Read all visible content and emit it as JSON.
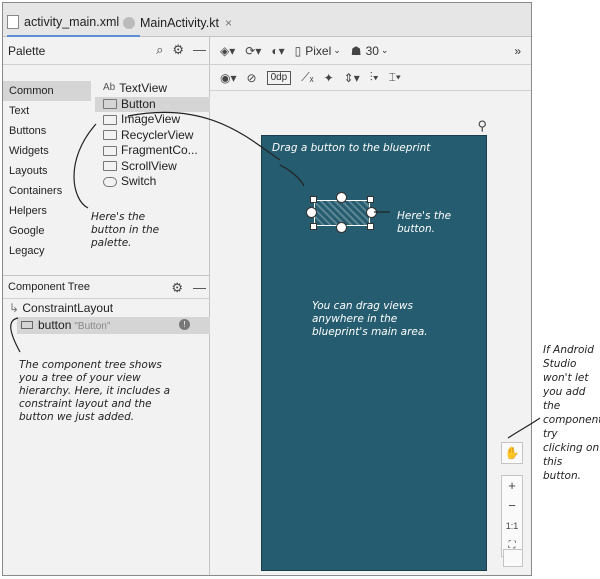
{
  "tabs": [
    {
      "label": "activity_main.xml"
    },
    {
      "label": "MainActivity.kt"
    }
  ],
  "palette": {
    "title": "Palette",
    "categories": [
      "Common",
      "Text",
      "Buttons",
      "Widgets",
      "Layouts",
      "Containers",
      "Helpers",
      "Google",
      "Legacy"
    ],
    "items": [
      {
        "label": "TextView",
        "icon": "Ab"
      },
      {
        "label": "Button",
        "icon": ""
      },
      {
        "label": "ImageView",
        "icon": ""
      },
      {
        "label": "RecyclerView",
        "icon": ""
      },
      {
        "label": "FragmentCo...",
        "icon": ""
      },
      {
        "label": "ScrollView",
        "icon": ""
      },
      {
        "label": "Switch",
        "icon": ""
      }
    ]
  },
  "component_tree": {
    "title": "Component Tree",
    "root": "ConstraintLayout",
    "child": "button",
    "child_hint": "\"Button\""
  },
  "toolbar": {
    "device": "Pixel",
    "api": "30",
    "margin": "0dp"
  },
  "zoom": {
    "plus": "+",
    "minus": "−",
    "one": "1:1"
  },
  "annotations": {
    "drag": "Drag a button to the blueprint",
    "here_button": "Here's the button.",
    "palette_note": "Here's the button in the palette.",
    "drag_views": "You can drag views anywhere in the blueprint's main area.",
    "tree_note": "The component tree shows you a tree of your view hierarchy. Here, it includes a constraint layout and the button we just added.",
    "side_note": "If Android Studio won't let you add the component, try clicking on this button."
  },
  "colors": {
    "blueprint": "#255c6f",
    "accent": "#5c8fd6"
  }
}
